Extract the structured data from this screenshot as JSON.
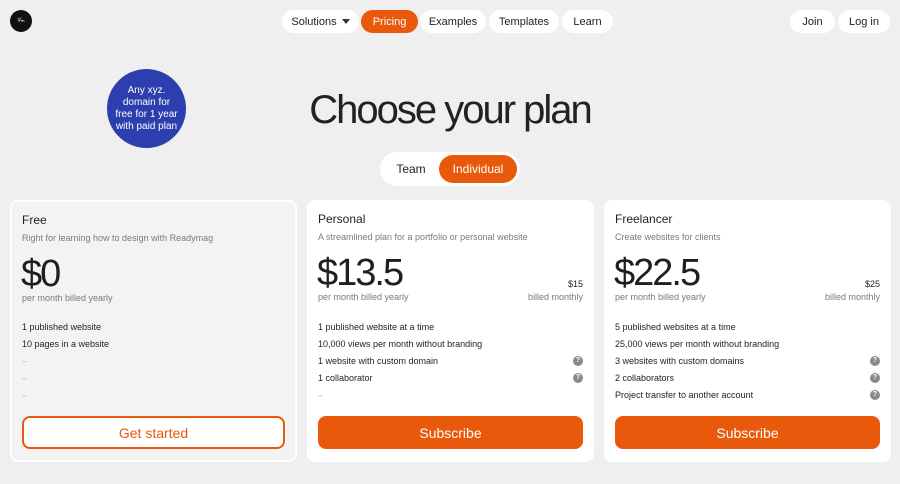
{
  "logo": {
    "glyph": "⁸⁄ₘ"
  },
  "nav": {
    "solutions": "Solutions",
    "pricing": "Pricing",
    "examples": "Examples",
    "templates": "Templates",
    "learn": "Learn",
    "join": "Join",
    "login": "Log in"
  },
  "badge": "Any xyz. domain for free for 1 year with paid plan",
  "title": "Choose your plan",
  "toggle": {
    "team": "Team",
    "individual": "Individual",
    "selected": "Individual"
  },
  "accent_color": "#e8590c",
  "badge_color": "#2d3fae",
  "plans": [
    {
      "name": "Free",
      "desc": "Right for learning how to design with Readymag",
      "price": "$0",
      "note": "per month billed yearly",
      "features": [
        "1 published website",
        "10 pages in a website",
        "–",
        "–",
        "–"
      ],
      "cta": "Get started"
    },
    {
      "name": "Personal",
      "desc": "A streamlined plan for a portfolio or personal website",
      "price": "$13.5",
      "note": "per month billed yearly",
      "monthly_amount": "$15",
      "monthly_note": "billed monthly",
      "features": [
        "1 published website at a time",
        "10,000 views per month without branding",
        "1 website with custom domain",
        "1 collaborator",
        "–"
      ],
      "cta": "Subscribe"
    },
    {
      "name": "Freelancer",
      "desc": "Create websites for clients",
      "price": "$22.5",
      "note": "per month billed yearly",
      "monthly_amount": "$25",
      "monthly_note": "billed monthly",
      "features": [
        "5 published websites at a time",
        "25,000 views per month without branding",
        "3 websites with custom domains",
        "2 collaborators",
        "Project transfer to another account"
      ],
      "cta": "Subscribe"
    }
  ]
}
